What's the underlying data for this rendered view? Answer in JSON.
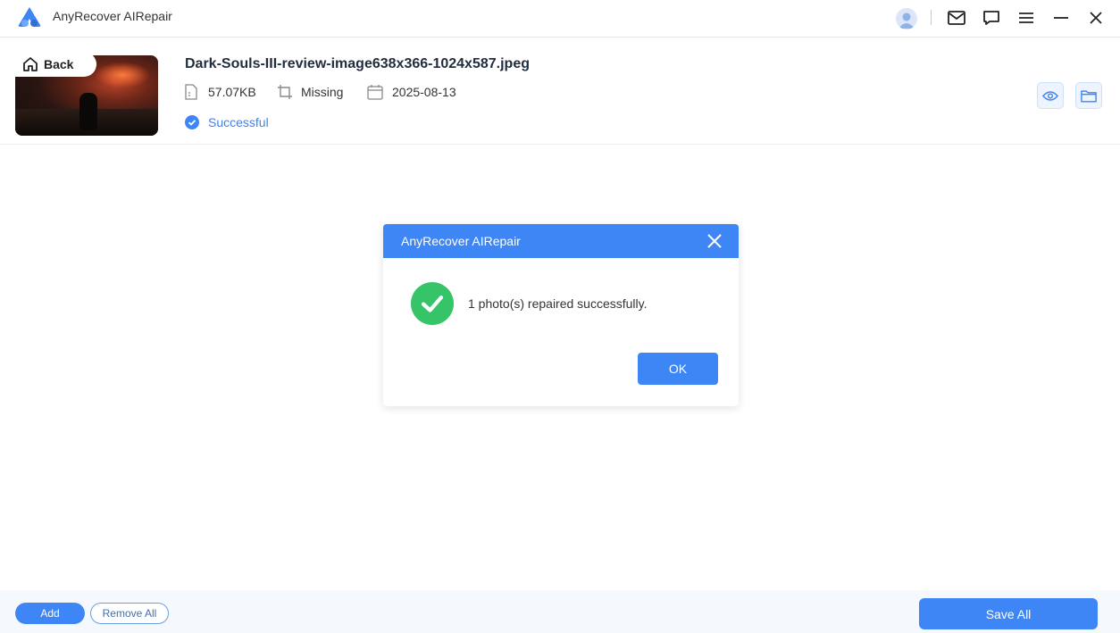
{
  "app": {
    "title": "AnyRecover AIRepair",
    "accent_color": "#3e86f5",
    "success_color": "#35c468"
  },
  "titlebar": {
    "icons": [
      "user-avatar-icon",
      "mail-icon",
      "feedback-icon",
      "menu-icon",
      "minimize-icon",
      "close-icon"
    ]
  },
  "file": {
    "back_label": "Back",
    "name": "Dark-Souls-III-review-image638x366-1024x587.jpeg",
    "size": "57.07KB",
    "resolution": "Missing",
    "date": "2025-08-13",
    "status": "Successful"
  },
  "dialog": {
    "title": "AnyRecover AIRepair",
    "message": "1 photo(s) repaired successfully.",
    "ok_label": "OK"
  },
  "footer": {
    "add_label": "Add",
    "remove_all_label": "Remove All",
    "save_all_label": "Save All"
  }
}
